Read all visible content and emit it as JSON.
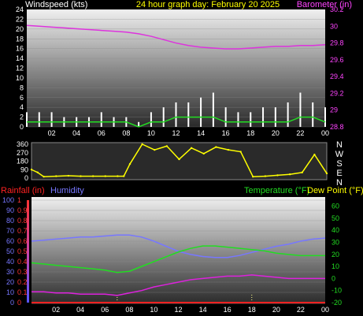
{
  "header": {
    "left_label": "Windspeed (kts)",
    "center_label": "24 hour graph day:  February 20 2025",
    "right_label": "Barometer (in)"
  },
  "labels": {
    "rainfall": "Rainfall (in)",
    "humidity": "Humidity",
    "temperature": "Temperature (°F)",
    "dew_point": "Dew Point (°F)",
    "compass": [
      "N",
      "W",
      "S",
      "E",
      "N"
    ]
  },
  "colors": {
    "wind": "#ffffff",
    "wind_avg": "#22dd22",
    "barometer": "#dd33dd",
    "direction": "#ffff00",
    "rainfall": "#ff2222",
    "humidity": "#7777ff",
    "temperature": "#22dd22",
    "dew_point": "#dd22dd"
  },
  "chart_data": [
    {
      "type": "line",
      "name": "wind-barometer",
      "x_ticks": [
        "02",
        "04",
        "06",
        "08",
        "10",
        "12",
        "14",
        "16",
        "18",
        "20",
        "22",
        "00"
      ],
      "wind_ticks": [
        0,
        2,
        4,
        6,
        8,
        10,
        12,
        14,
        16,
        18,
        20,
        22,
        24
      ],
      "wind_ylim": [
        0,
        24
      ],
      "baro_ticks": [
        "28.8",
        "29",
        "29.2",
        "29.4",
        "29.6",
        "29.8",
        "30",
        "30.2"
      ],
      "baro_ylim": [
        28.8,
        30.2
      ],
      "x": [
        0,
        1,
        2,
        3,
        4,
        5,
        6,
        7,
        8,
        9,
        10,
        11,
        12,
        13,
        14,
        15,
        16,
        17,
        18,
        19,
        20,
        21,
        22,
        23,
        24
      ],
      "series": [
        {
          "key": "wind_gust",
          "values": [
            3,
            3,
            3,
            2,
            2,
            2,
            3,
            2,
            2,
            1,
            3,
            4,
            5,
            5,
            6,
            7,
            4,
            3,
            3,
            4,
            4,
            5,
            7,
            5,
            4
          ]
        },
        {
          "key": "wind_avg",
          "values": [
            1,
            1,
            1,
            1,
            1,
            1,
            1,
            1,
            1,
            0,
            1,
            1,
            2,
            2,
            2,
            2,
            1,
            1,
            1,
            1,
            1,
            1,
            2,
            2,
            1
          ]
        },
        {
          "key": "barometer",
          "values": [
            30.01,
            30.0,
            29.99,
            29.98,
            29.97,
            29.96,
            29.95,
            29.94,
            29.93,
            29.91,
            29.88,
            29.84,
            29.8,
            29.77,
            29.75,
            29.74,
            29.73,
            29.73,
            29.74,
            29.75,
            29.76,
            29.76,
            29.77,
            29.77,
            29.78
          ]
        }
      ]
    },
    {
      "type": "scatter",
      "name": "wind-direction",
      "y_ticks": [
        0,
        90,
        180,
        270,
        360
      ],
      "ylim": [
        0,
        360
      ],
      "x": [
        0,
        0.5,
        1,
        2,
        3,
        4,
        5,
        6,
        7,
        7.5,
        8,
        9,
        10,
        11,
        12,
        13,
        14,
        15,
        16,
        17,
        18,
        19,
        20,
        21,
        22,
        23,
        24
      ],
      "values": [
        90,
        60,
        15,
        20,
        25,
        20,
        20,
        20,
        20,
        20,
        150,
        360,
        300,
        340,
        200,
        320,
        260,
        330,
        300,
        280,
        15,
        20,
        30,
        40,
        60,
        250,
        50
      ]
    },
    {
      "type": "line",
      "name": "temp-humidity",
      "x_ticks": [
        "02",
        "04",
        "06",
        "08",
        "10",
        "12",
        "14",
        "16",
        "18",
        "20",
        "22",
        "00"
      ],
      "left_ticks": [
        0,
        10,
        20,
        30,
        40,
        50,
        60,
        70,
        80,
        90,
        100
      ],
      "rain_ticks": [
        "0",
        "0.1",
        "0.2",
        "0.3",
        "0.4",
        "0.5",
        "0.6",
        "0.7",
        "0.8",
        "0.9",
        "1"
      ],
      "temp_ticks": [
        -20,
        -10,
        0,
        10,
        20,
        30,
        40,
        50,
        60
      ],
      "humidity_ylim": [
        0,
        100
      ],
      "rain_ylim": [
        0,
        1
      ],
      "temp_ylim": [
        -20,
        65
      ],
      "x": [
        0,
        1,
        2,
        3,
        4,
        5,
        6,
        7,
        8,
        9,
        10,
        11,
        12,
        13,
        14,
        15,
        16,
        17,
        18,
        19,
        20,
        21,
        22,
        23,
        24
      ],
      "series": [
        {
          "key": "humidity",
          "values": [
            60,
            61,
            62,
            63,
            64,
            64,
            65,
            66,
            66,
            64,
            60,
            55,
            50,
            47,
            45,
            44,
            44,
            46,
            49,
            52,
            55,
            57,
            60,
            62,
            63
          ]
        },
        {
          "key": "temperature",
          "values": [
            13,
            12,
            11,
            10,
            9,
            8,
            7,
            5,
            6,
            10,
            14,
            18,
            22,
            25,
            27,
            27,
            26,
            25,
            24,
            23,
            21,
            20,
            19,
            19,
            19
          ]
        },
        {
          "key": "dew_point",
          "values": [
            -11,
            -11,
            -12,
            -12,
            -13,
            -13,
            -13,
            -14,
            -12,
            -10,
            -7,
            -5,
            -3,
            -1,
            0,
            1,
            2,
            2,
            3,
            2,
            1,
            0,
            0,
            0,
            0
          ]
        },
        {
          "key": "rainfall",
          "values": [
            0,
            0,
            0,
            0,
            0,
            0,
            0,
            0,
            0,
            0,
            0,
            0,
            0,
            0,
            0,
            0,
            0,
            0,
            0,
            0,
            0,
            0,
            0,
            0,
            0
          ]
        }
      ]
    }
  ]
}
